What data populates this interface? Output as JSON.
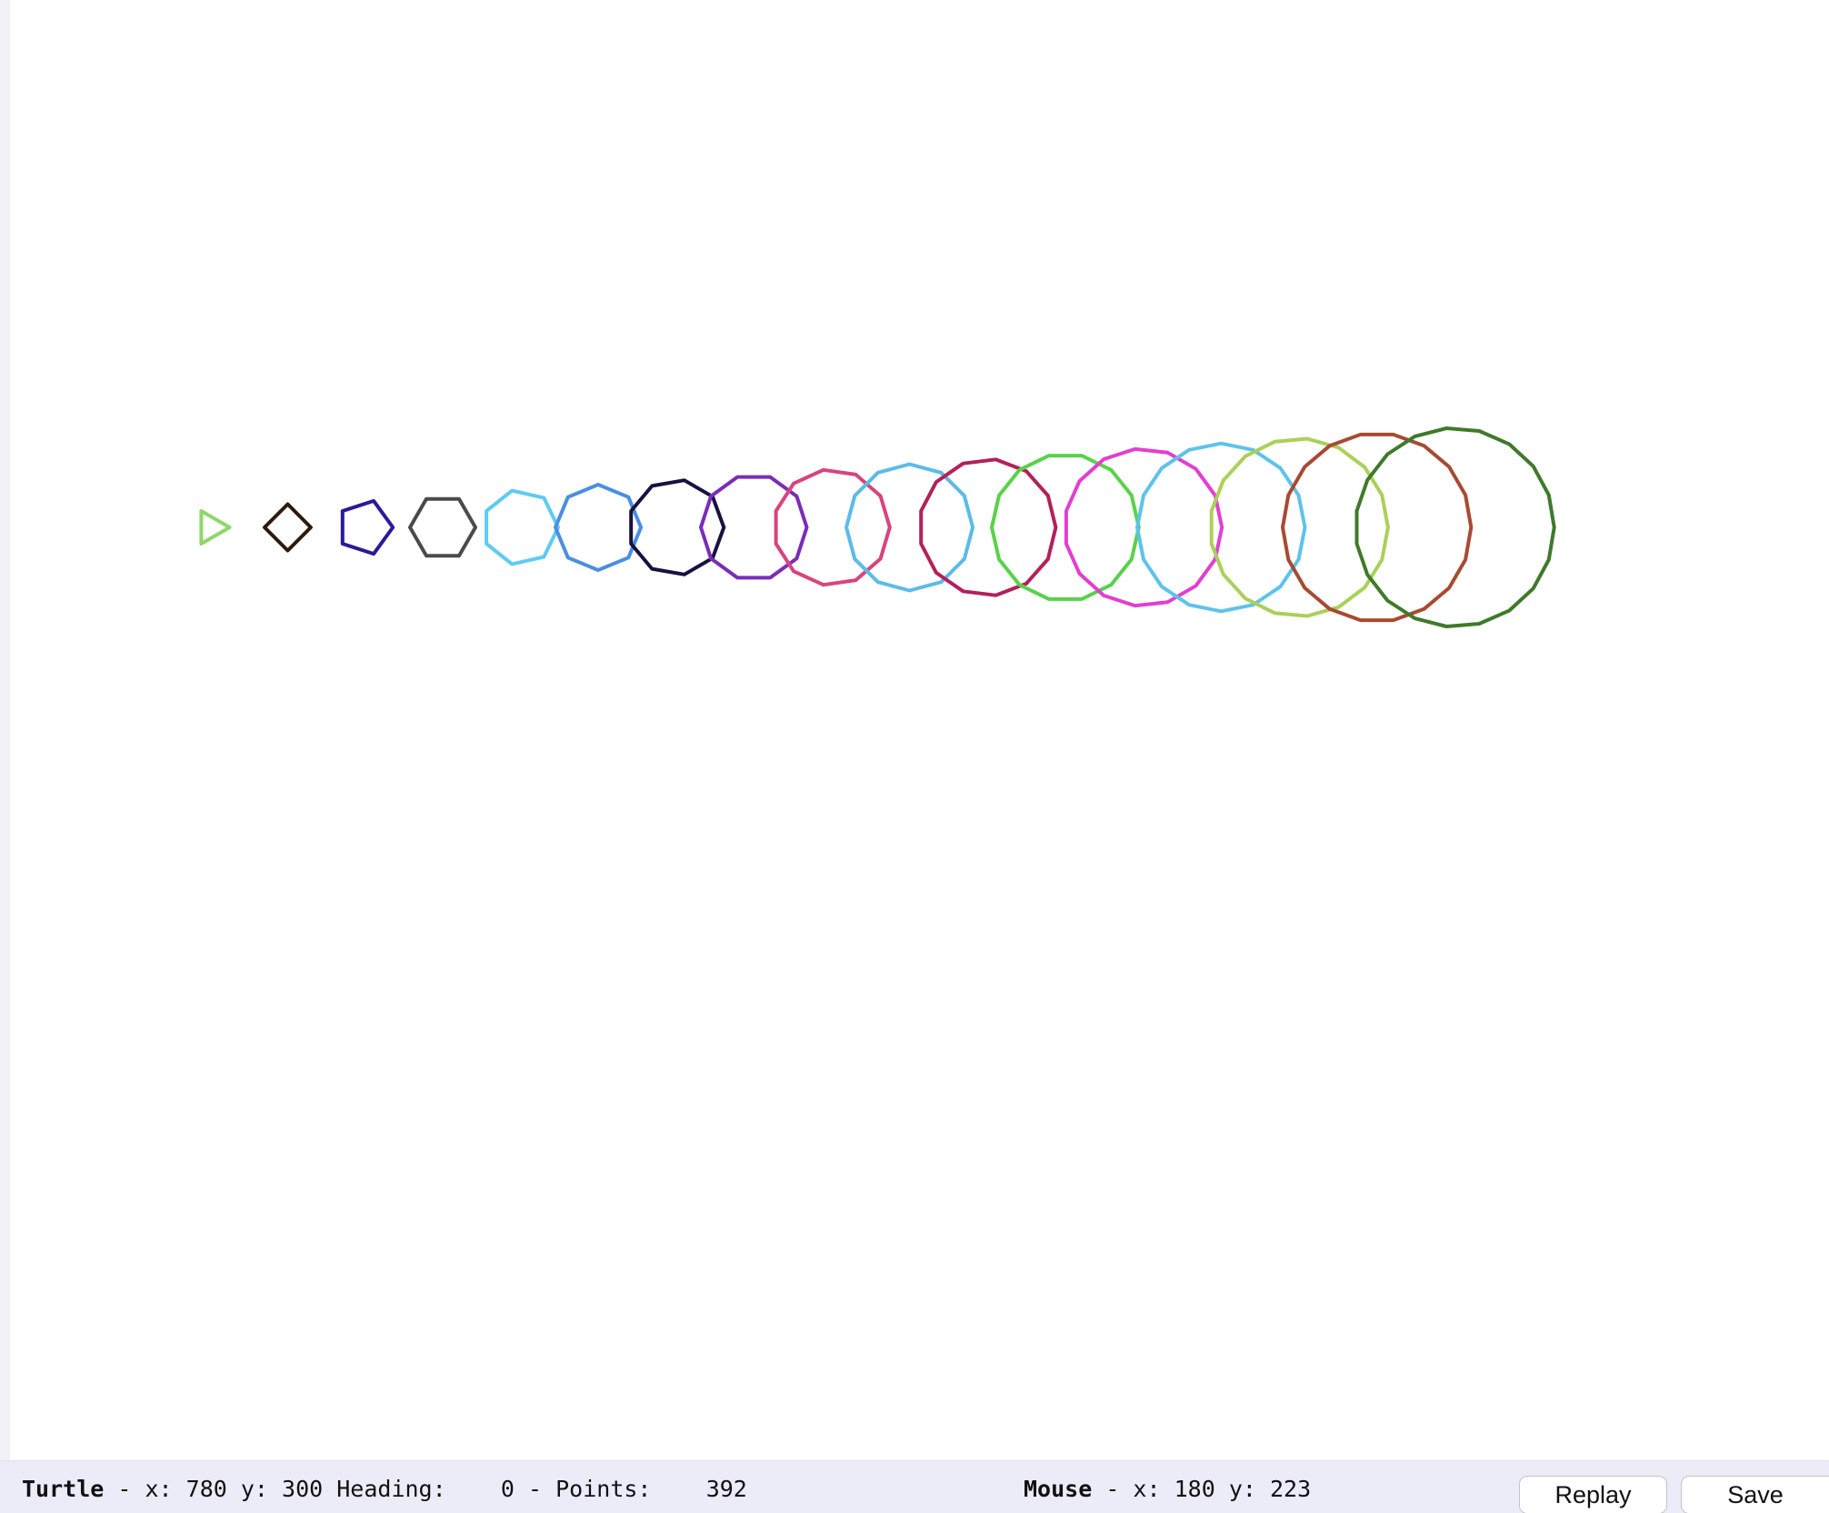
{
  "status": {
    "turtle_label": "Turtle",
    "turtle_sep": " - ",
    "turtle_x_label": "x:",
    "turtle_x": "780",
    "turtle_y_label": "y:",
    "turtle_y": "300",
    "heading_label": "Heading:",
    "heading": "0",
    "points_label": "Points:",
    "points": "392",
    "mouse_label": "Mouse",
    "mouse_sep": " - ",
    "mouse_x_label": "x:",
    "mouse_x": "180",
    "mouse_y_label": "y:",
    "mouse_y": "223"
  },
  "buttons": {
    "replay_label": "Replay",
    "save_label": "Save"
  },
  "drawing": {
    "shapes": [
      {
        "sides": 3,
        "color": "#8fd86b"
      },
      {
        "sides": 4,
        "color": "#2b1a0e"
      },
      {
        "sides": 5,
        "color": "#2a1a9a"
      },
      {
        "sides": 6,
        "color": "#4a4a4a"
      },
      {
        "sides": 7,
        "color": "#5ecbf2"
      },
      {
        "sides": 8,
        "color": "#4a8fe0"
      },
      {
        "sides": 9,
        "color": "#17123f"
      },
      {
        "sides": 10,
        "color": "#7a2db8"
      },
      {
        "sides": 11,
        "color": "#d9447e"
      },
      {
        "sides": 12,
        "color": "#5cbbe8"
      },
      {
        "sides": 13,
        "color": "#b3205a"
      },
      {
        "sides": 14,
        "color": "#58d24a"
      },
      {
        "sides": 15,
        "color": "#e23ed2"
      },
      {
        "sides": 16,
        "color": "#5ec3ea"
      },
      {
        "sides": 17,
        "color": "#abd05a"
      },
      {
        "sides": 18,
        "color": "#a84a32"
      },
      {
        "sides": 19,
        "color": "#3f7a2a"
      }
    ]
  }
}
